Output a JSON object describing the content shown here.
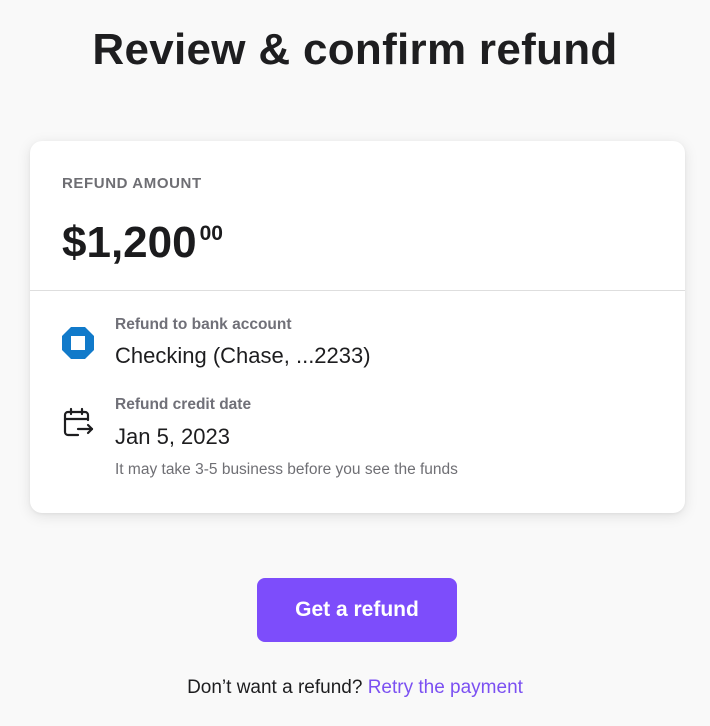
{
  "page": {
    "title": "Review & confirm refund"
  },
  "refund": {
    "amount_label": "REFUND AMOUNT",
    "amount_main": "$1,200",
    "amount_cents": "00"
  },
  "bank_account": {
    "icon": "chase-bank-logo-icon",
    "label": "Refund to bank account",
    "value": "Checking (Chase, ...2233)"
  },
  "credit_date": {
    "icon": "calendar-arrow-icon",
    "label": "Refund credit date",
    "value": "Jan 5, 2023",
    "note": "It may take 3-5 business before you see the funds"
  },
  "actions": {
    "primary_button": "Get a refund",
    "footer_text": "Don’t want a refund?",
    "footer_link": "Retry the payment"
  },
  "colors": {
    "accent": "#7d4dfb",
    "link": "#7b50f2",
    "chase_blue": "#117aca",
    "background": "#f9f9f9"
  }
}
